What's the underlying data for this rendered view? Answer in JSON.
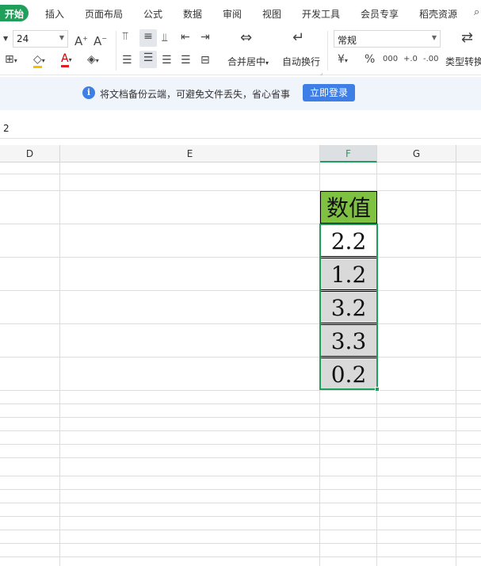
{
  "menu": {
    "tabs": [
      "开始",
      "插入",
      "页面布局",
      "公式",
      "数据",
      "审阅",
      "视图",
      "开发工具",
      "会员专享",
      "稻壳资源"
    ]
  },
  "toolbar": {
    "font_size": "24",
    "number_format": "常规",
    "merge_label": "合并居中",
    "wrap_label": "自动换行",
    "type_convert_label": "类型转换",
    "currency_symbol": "¥",
    "percent_symbol": "%",
    "thousands_symbol": "000",
    "increase_decimal": "+.0",
    "decrease_decimal": "-.00"
  },
  "notice": {
    "message": "将文档备份云端，可避免文件丢失，省心省事",
    "login_button": "立即登录"
  },
  "formula_bar": {
    "value": "2"
  },
  "columns": [
    "D",
    "E",
    "F",
    "G"
  ],
  "cells": {
    "header": "数值",
    "values": [
      "2.2",
      "1.2",
      "3.2",
      "3.3",
      "0.2"
    ]
  },
  "colors": {
    "accent": "#1f9f5a",
    "header_fill": "#7fc241",
    "value_fill": "#d9d9d9",
    "notice_button": "#3d7fe6"
  }
}
